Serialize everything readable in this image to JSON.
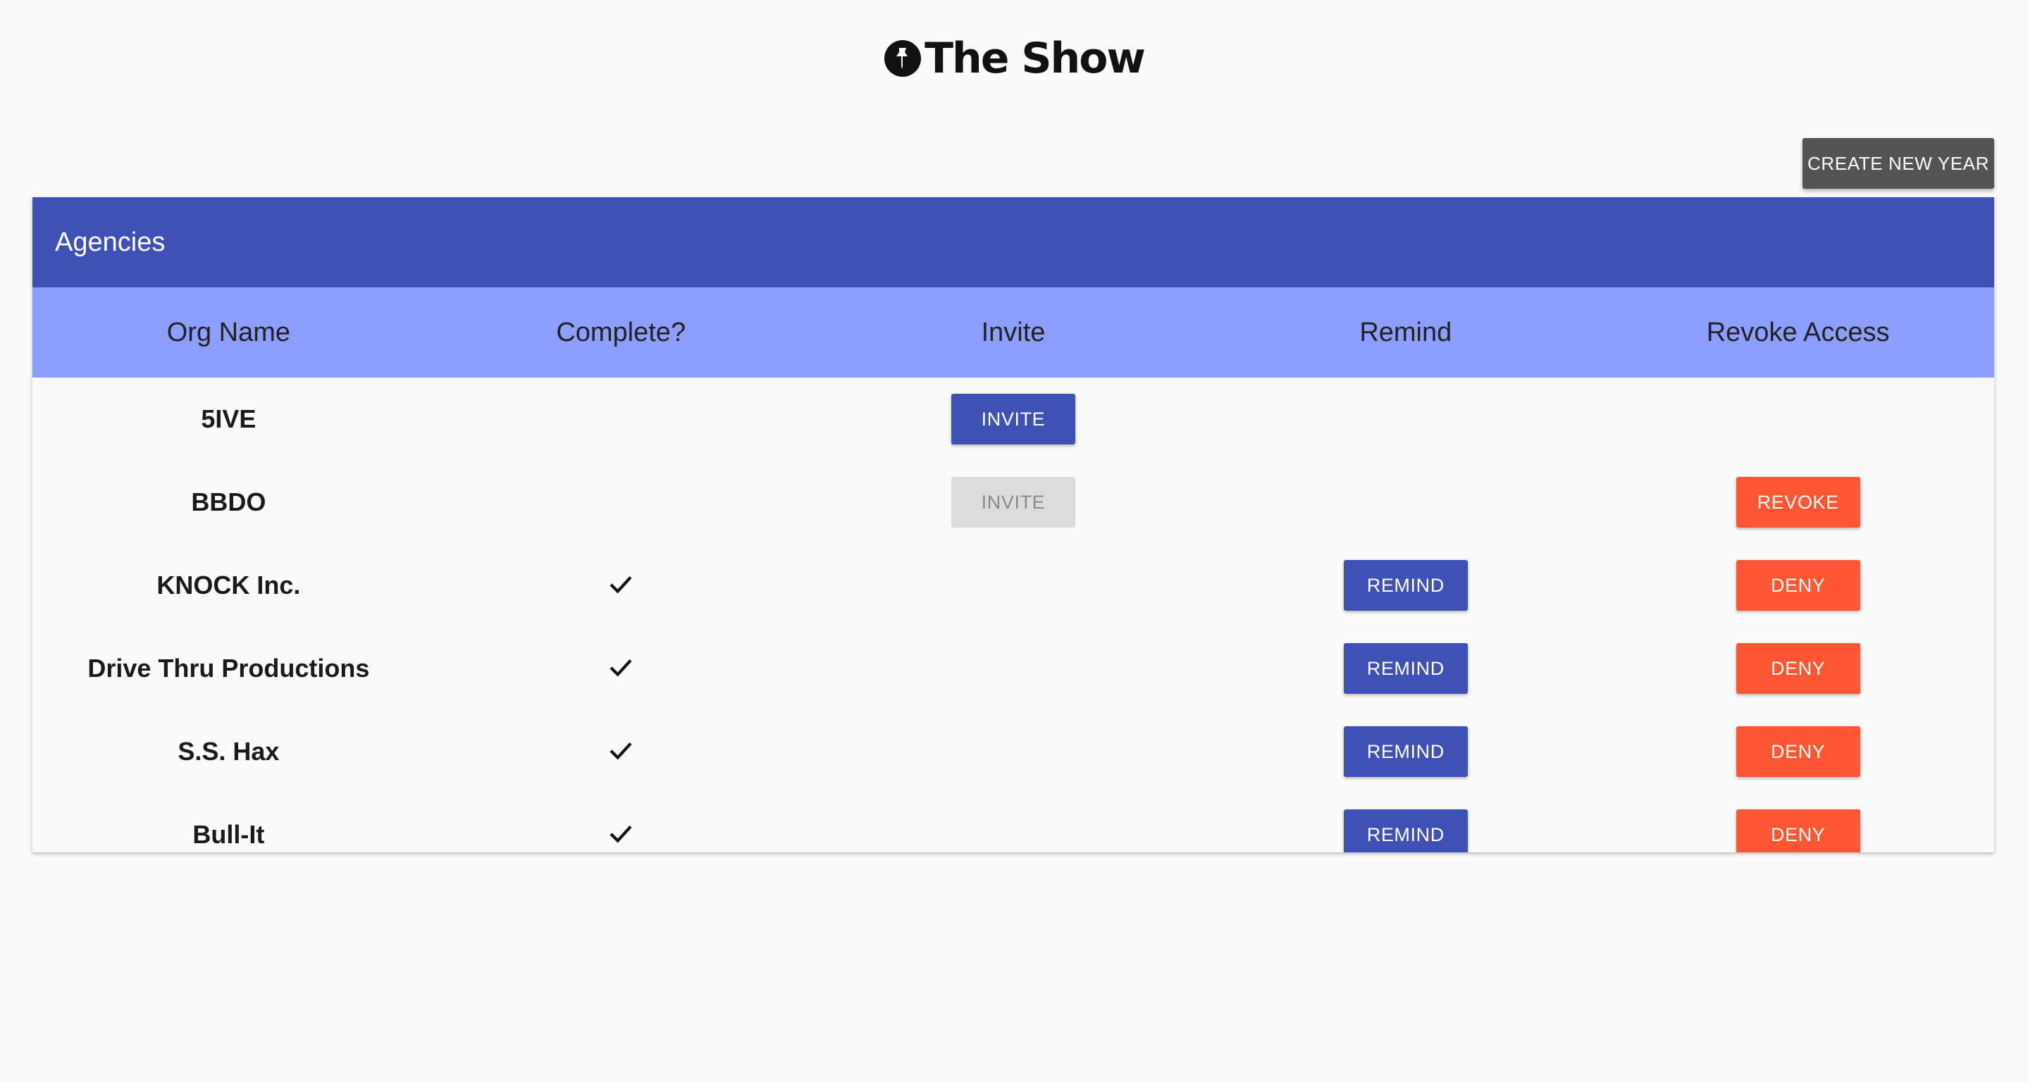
{
  "app": {
    "title": "The Show"
  },
  "actions": {
    "create_new_year": "CREATE NEW YEAR"
  },
  "table": {
    "title": "Agencies",
    "columns": [
      "Org Name",
      "Complete?",
      "Invite",
      "Remind",
      "Revoke Access"
    ],
    "rows": [
      {
        "org": "5IVE",
        "complete": false,
        "invite": "INVITE",
        "invite_enabled": true,
        "remind": null,
        "revoke": null
      },
      {
        "org": "BBDO",
        "complete": false,
        "invite": "INVITE",
        "invite_enabled": false,
        "remind": null,
        "revoke": "REVOKE"
      },
      {
        "org": "KNOCK Inc.",
        "complete": true,
        "invite": null,
        "remind": "REMIND",
        "revoke": "DENY"
      },
      {
        "org": "Drive Thru Productions",
        "complete": true,
        "invite": null,
        "remind": "REMIND",
        "revoke": "DENY"
      },
      {
        "org": "S.S. Hax",
        "complete": true,
        "invite": null,
        "remind": "REMIND",
        "revoke": "DENY"
      },
      {
        "org": "Bull-It",
        "complete": true,
        "invite": null,
        "remind": "REMIND",
        "revoke": "DENY"
      }
    ]
  },
  "colors": {
    "primary": "#3f51b5",
    "header_row": "#8c9eff",
    "danger": "#ff5733",
    "dark_button": "#545454"
  }
}
